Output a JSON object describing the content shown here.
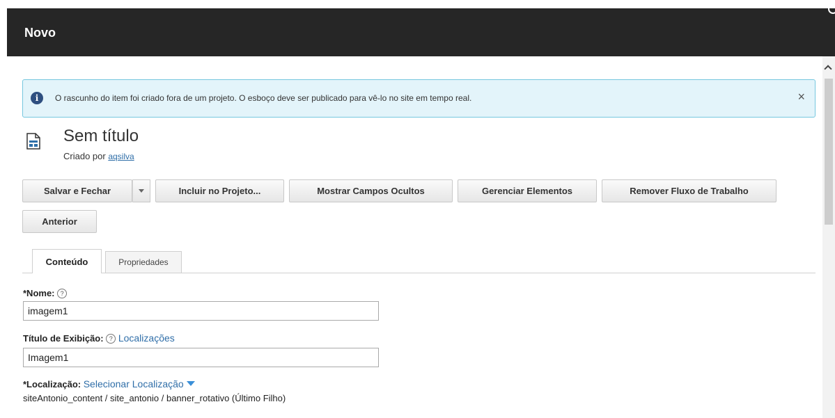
{
  "window": {
    "title": "Novo"
  },
  "alert": {
    "message": "O rascunho do item foi criado fora de um projeto. O esboço deve ser publicado para vê-lo no site em tempo real.",
    "close_label": "×"
  },
  "header": {
    "title": "Sem título",
    "created_by_prefix": "Criado por",
    "created_by_user": "aqsilva"
  },
  "toolbar": {
    "save_close": "Salvar e Fechar",
    "include_project": "Incluir no Projeto...",
    "show_hidden": "Mostrar Campos Ocultos",
    "manage_elements": "Gerenciar Elementos",
    "remove_workflow": "Remover Fluxo de Trabalho",
    "previous": "Anterior"
  },
  "tabs": [
    {
      "label": "Conteúdo",
      "active": true
    },
    {
      "label": "Propriedades",
      "active": false
    }
  ],
  "form": {
    "name_label": "*Nome:",
    "name_value": "imagem1",
    "display_title_label": "Título de Exibição:",
    "localizations_link": "Localizações",
    "display_title_value": "Imagem1",
    "location_label": "*Localização:",
    "select_location_link": "Selecionar Localização",
    "location_path": "siteAntonio_content / site_antonio / banner_rotativo (Último Filho)"
  },
  "help_glyph": "?",
  "colors": {
    "titlebar": "#262626",
    "alert_bg": "#e3f4fa",
    "alert_border": "#76c7df",
    "link": "#2f6ea8"
  }
}
